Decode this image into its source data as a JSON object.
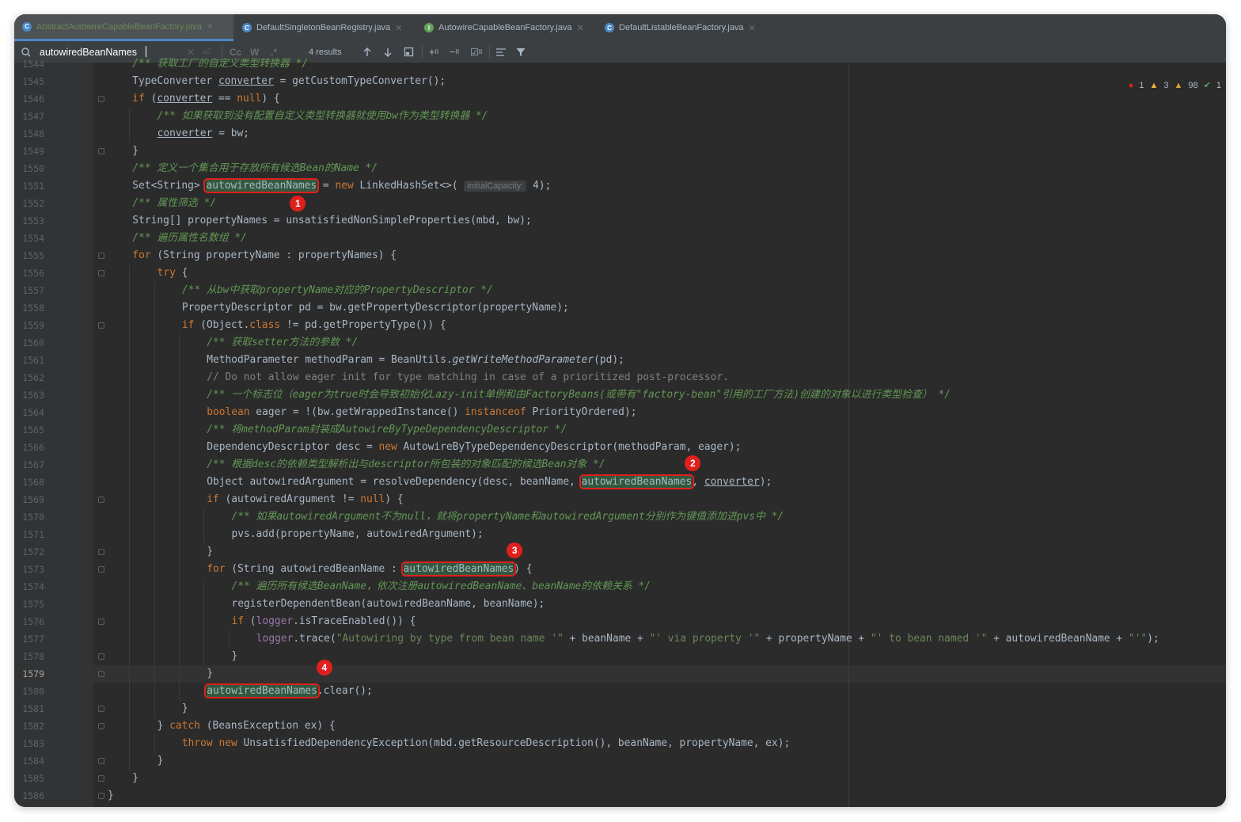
{
  "tabs": [
    {
      "label": "AbstractAutowireCapableBeanFactory.java",
      "icon": "class-icon",
      "active": true
    },
    {
      "label": "DefaultSingletonBeanRegistry.java",
      "icon": "class-icon",
      "active": false
    },
    {
      "label": "AutowireCapableBeanFactory.java",
      "icon": "interface-icon",
      "active": false
    },
    {
      "label": "DefaultListableBeanFactory.java",
      "icon": "class-icon",
      "active": false
    }
  ],
  "search": {
    "query": "autowiredBeanNames",
    "case_label": "Cc",
    "words_label": "W",
    "regex_label": ".*",
    "results": "4 results"
  },
  "inspections": {
    "errors": "1",
    "warnings": "3",
    "weak_warnings": "98",
    "ok": "1"
  },
  "lines": [
    {
      "n": "1544",
      "fold": false
    },
    {
      "n": "1545",
      "fold": false
    },
    {
      "n": "1546",
      "fold": true
    },
    {
      "n": "1547",
      "fold": false
    },
    {
      "n": "1548",
      "fold": false
    },
    {
      "n": "1549",
      "fold": true
    },
    {
      "n": "1550",
      "fold": false
    },
    {
      "n": "1551",
      "fold": false
    },
    {
      "n": "1552",
      "fold": false
    },
    {
      "n": "1553",
      "fold": false
    },
    {
      "n": "1554",
      "fold": false
    },
    {
      "n": "1555",
      "fold": true
    },
    {
      "n": "1556",
      "fold": true
    },
    {
      "n": "1557",
      "fold": false
    },
    {
      "n": "1558",
      "fold": false
    },
    {
      "n": "1559",
      "fold": true
    },
    {
      "n": "1560",
      "fold": false
    },
    {
      "n": "1561",
      "fold": false
    },
    {
      "n": "1562",
      "fold": false
    },
    {
      "n": "1563",
      "fold": false
    },
    {
      "n": "1564",
      "fold": false
    },
    {
      "n": "1565",
      "fold": false
    },
    {
      "n": "1566",
      "fold": false
    },
    {
      "n": "1567",
      "fold": false
    },
    {
      "n": "1568",
      "fold": false
    },
    {
      "n": "1569",
      "fold": true
    },
    {
      "n": "1570",
      "fold": false
    },
    {
      "n": "1571",
      "fold": false
    },
    {
      "n": "1572",
      "fold": true
    },
    {
      "n": "1573",
      "fold": true
    },
    {
      "n": "1574",
      "fold": false
    },
    {
      "n": "1575",
      "fold": false
    },
    {
      "n": "1576",
      "fold": true
    },
    {
      "n": "1577",
      "fold": false
    },
    {
      "n": "1578",
      "fold": true
    },
    {
      "n": "1579",
      "fold": true
    },
    {
      "n": "1580",
      "fold": false
    },
    {
      "n": "1581",
      "fold": true
    },
    {
      "n": "1582",
      "fold": true
    },
    {
      "n": "1583",
      "fold": false
    },
    {
      "n": "1584",
      "fold": true
    },
    {
      "n": "1585",
      "fold": true
    },
    {
      "n": "1586",
      "fold": true
    }
  ],
  "current_line": "1579",
  "code": [
    {
      "i": 2,
      "t": [
        [
          "cm",
          "/** 获取工厂的自定义类型转换器 */"
        ]
      ]
    },
    {
      "i": 2,
      "t": [
        [
          "",
          "TypeConverter "
        ],
        [
          "ul",
          "converter"
        ],
        [
          "",
          " = getCustomTypeConverter();"
        ]
      ]
    },
    {
      "i": 2,
      "t": [
        [
          "kw",
          "if "
        ],
        [
          "",
          "("
        ],
        [
          "ul",
          "converter"
        ],
        [
          "",
          " == "
        ],
        [
          "kw",
          "null"
        ],
        [
          "",
          ") {"
        ]
      ]
    },
    {
      "i": 3,
      "t": [
        [
          "cm",
          "/** 如果获取到没有配置自定义类型转换器就使用bw作为类型转换器 */"
        ]
      ]
    },
    {
      "i": 3,
      "t": [
        [
          "ul",
          "converter"
        ],
        [
          "",
          " = bw;"
        ]
      ]
    },
    {
      "i": 2,
      "t": [
        [
          "",
          "}"
        ]
      ]
    },
    {
      "i": 2,
      "t": [
        [
          "cm",
          "/** 定义一个集合用于存放所有候选Bean的Name */"
        ]
      ]
    },
    {
      "i": 2,
      "t": [
        [
          "",
          "Set<String> "
        ],
        [
          "hl",
          "autowiredBeanNames"
        ],
        [
          "",
          " = "
        ],
        [
          "kw",
          "new "
        ],
        [
          "",
          "LinkedHashSet<>( "
        ],
        [
          "hint",
          "initialCapacity:"
        ],
        [
          "",
          " 4);"
        ]
      ]
    },
    {
      "i": 2,
      "t": [
        [
          "cm",
          "/** 属性筛选 */"
        ]
      ]
    },
    {
      "i": 2,
      "t": [
        [
          "",
          "String[] propertyNames = unsatisfiedNonSimpleProperties(mbd, bw);"
        ]
      ]
    },
    {
      "i": 2,
      "t": [
        [
          "cm",
          "/** 遍历属性名数组 */"
        ]
      ]
    },
    {
      "i": 2,
      "t": [
        [
          "kw",
          "for "
        ],
        [
          "",
          "(String propertyName : propertyNames) {"
        ]
      ]
    },
    {
      "i": 3,
      "t": [
        [
          "kw",
          "try "
        ],
        [
          "",
          "{"
        ]
      ]
    },
    {
      "i": 4,
      "t": [
        [
          "cm",
          "/** 从bw中获取propertyName对应的PropertyDescriptor */"
        ]
      ]
    },
    {
      "i": 4,
      "t": [
        [
          "",
          "PropertyDescriptor pd = bw.getPropertyDescriptor(propertyName);"
        ]
      ]
    },
    {
      "i": 4,
      "t": [
        [
          "kw",
          "if "
        ],
        [
          "",
          "(Object."
        ],
        [
          "kw",
          "class"
        ],
        [
          "",
          " != pd.getPropertyType()) {"
        ]
      ]
    },
    {
      "i": 5,
      "t": [
        [
          "cm",
          "/** 获取setter方法的参数 */"
        ]
      ]
    },
    {
      "i": 5,
      "t": [
        [
          "",
          "MethodParameter methodParam = BeanUtils."
        ],
        [
          "ital",
          "getWriteMethodParameter"
        ],
        [
          "",
          "(pd);"
        ]
      ]
    },
    {
      "i": 5,
      "t": [
        [
          "lc",
          "// Do not allow eager init for type matching in case of a prioritized post-processor."
        ]
      ]
    },
    {
      "i": 5,
      "t": [
        [
          "cm",
          "/** 一个标志位（eager为true时会导致初始化Lazy-init单例和由FactoryBeans(或带有\"factory-bean\"引用的工厂方法)创建的对象以进行类型检查） */"
        ]
      ]
    },
    {
      "i": 5,
      "t": [
        [
          "kw",
          "boolean "
        ],
        [
          "",
          "eager = !(bw.getWrappedInstance() "
        ],
        [
          "kw",
          "instanceof "
        ],
        [
          "",
          "PriorityOrdered);"
        ]
      ]
    },
    {
      "i": 5,
      "t": [
        [
          "cm",
          "/** 将methodParam封装成AutowireByTypeDependencyDescriptor */"
        ]
      ]
    },
    {
      "i": 5,
      "t": [
        [
          "",
          "DependencyDescriptor desc = "
        ],
        [
          "kw",
          "new "
        ],
        [
          "",
          "AutowireByTypeDependencyDescriptor(methodParam, eager);"
        ]
      ]
    },
    {
      "i": 5,
      "t": [
        [
          "cm",
          "/** 根据desc的依赖类型解析出与descriptor所包装的对象匹配的候选Bean对象 */"
        ]
      ]
    },
    {
      "i": 5,
      "t": [
        [
          "",
          "Object autowiredArgument = resolveDependency(desc, beanName, "
        ],
        [
          "hl",
          "autowiredBeanNames"
        ],
        [
          "",
          ", "
        ],
        [
          "ul",
          "converter"
        ],
        [
          "",
          ");"
        ]
      ]
    },
    {
      "i": 5,
      "t": [
        [
          "kw",
          "if "
        ],
        [
          "",
          "(autowiredArgument != "
        ],
        [
          "kw",
          "null"
        ],
        [
          "",
          ") {"
        ]
      ]
    },
    {
      "i": 6,
      "t": [
        [
          "cm",
          "/** 如果autowiredArgument不为null，就将propertyName和autowiredArgument分别作为键值添加进pvs中 */"
        ]
      ]
    },
    {
      "i": 6,
      "t": [
        [
          "",
          "pvs.add(propertyName, autowiredArgument);"
        ]
      ]
    },
    {
      "i": 5,
      "t": [
        [
          "",
          "}"
        ]
      ]
    },
    {
      "i": 5,
      "t": [
        [
          "kw",
          "for "
        ],
        [
          "",
          "(String autowiredBeanName : "
        ],
        [
          "hl",
          "autowiredBeanNames"
        ],
        [
          "",
          ") {"
        ]
      ]
    },
    {
      "i": 6,
      "t": [
        [
          "cm",
          "/** 遍历所有候选BeanName，依次注册autowiredBeanName、beanName的依赖关系 */"
        ]
      ]
    },
    {
      "i": 6,
      "t": [
        [
          "",
          "registerDependentBean(autowiredBeanName, beanName);"
        ]
      ]
    },
    {
      "i": 6,
      "t": [
        [
          "kw",
          "if "
        ],
        [
          "",
          "("
        ],
        [
          "fld",
          "logger"
        ],
        [
          "",
          ".isTraceEnabled()) {"
        ]
      ]
    },
    {
      "i": 7,
      "t": [
        [
          "fld",
          "logger"
        ],
        [
          "",
          ".trace("
        ],
        [
          "str",
          "\"Autowiring by type from bean name '\""
        ],
        [
          "",
          " + beanName + "
        ],
        [
          "str",
          "\"' via property '\""
        ],
        [
          "",
          " + propertyName + "
        ],
        [
          "str",
          "\"' to bean named '\""
        ],
        [
          "",
          " + autowiredBeanName + "
        ],
        [
          "str",
          "\"'\""
        ],
        [
          "",
          ");"
        ]
      ]
    },
    {
      "i": 6,
      "t": [
        [
          "",
          "}"
        ]
      ]
    },
    {
      "i": 5,
      "t": [
        [
          "",
          "}"
        ]
      ]
    },
    {
      "i": 5,
      "t": [
        [
          "hl",
          "autowiredBeanNames"
        ],
        [
          "",
          ".clear();"
        ]
      ]
    },
    {
      "i": 4,
      "t": [
        [
          "",
          "}"
        ]
      ]
    },
    {
      "i": 3,
      "t": [
        [
          "",
          "} "
        ],
        [
          "kw",
          "catch "
        ],
        [
          "",
          "(BeansException ex) {"
        ]
      ]
    },
    {
      "i": 4,
      "t": [
        [
          "kw",
          "throw new "
        ],
        [
          "",
          "UnsatisfiedDependencyException(mbd.getResourceDescription(), beanName, propertyName, ex);"
        ]
      ]
    },
    {
      "i": 3,
      "t": [
        [
          "",
          "}"
        ]
      ]
    },
    {
      "i": 2,
      "t": [
        [
          "",
          "}"
        ]
      ]
    },
    {
      "i": 1,
      "t": [
        [
          "",
          "}"
        ]
      ]
    }
  ],
  "annotations": [
    {
      "label": "1",
      "line": "1551"
    },
    {
      "label": "2",
      "line": "1568"
    },
    {
      "label": "3",
      "line": "1573"
    },
    {
      "label": "4",
      "line": "1580"
    }
  ]
}
